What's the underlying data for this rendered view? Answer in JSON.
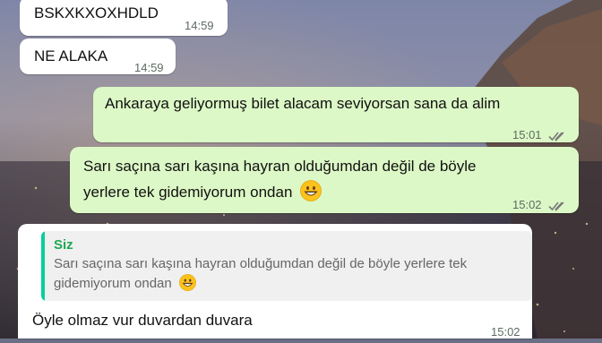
{
  "theme": {
    "incoming_bubble": "#ffffff",
    "outgoing_bubble": "#dcf8c6",
    "quote_accent": "#06cf9c",
    "quote_author_color": "#1fa855",
    "read_tick_color": "#7a7a7a"
  },
  "messages": [
    {
      "direction": "incoming",
      "text": "BSKXKXOXHDLD",
      "time": "14:59"
    },
    {
      "direction": "incoming",
      "text": "NE ALAKA",
      "time": "14:59"
    },
    {
      "direction": "outgoing",
      "text": "Ankaraya geliyormuş bilet alacam seviyorsan sana da alim",
      "time": "15:01",
      "status_icon": "double-check-icon"
    },
    {
      "direction": "outgoing",
      "line1": "Sarı saçına sarı kaşına hayran olduğumdan değil de böyle",
      "line2": "yerlere tek gidemiyorum ondan",
      "emoji": "grinning-face-emoji",
      "time": "15:02",
      "status_icon": "double-check-icon"
    },
    {
      "direction": "incoming",
      "quote": {
        "author": "Siz",
        "line1": "Sarı saçına sarı kaşına hayran olduğumdan değil de böyle yerlere tek",
        "line2": "gidemiyorum ondan",
        "emoji": "grinning-face-emoji"
      },
      "text": "Öyle olmaz vur duvardan duvara",
      "time": "15:02"
    }
  ]
}
